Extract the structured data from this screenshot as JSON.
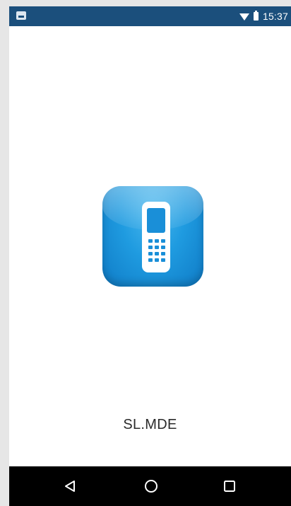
{
  "status_bar": {
    "time": "15:37",
    "left_icon": "image-notification-icon",
    "wifi_icon": "wifi-icon",
    "battery_icon": "battery-icon",
    "background_color": "#1b4f7c"
  },
  "app": {
    "name": "SL.MDE",
    "icon": "handheld-scanner-icon",
    "icon_color": "#1f9be0"
  },
  "nav_bar": {
    "back_icon": "back-triangle-icon",
    "home_icon": "home-circle-icon",
    "recents_icon": "recents-square-icon",
    "background_color": "#000000"
  }
}
